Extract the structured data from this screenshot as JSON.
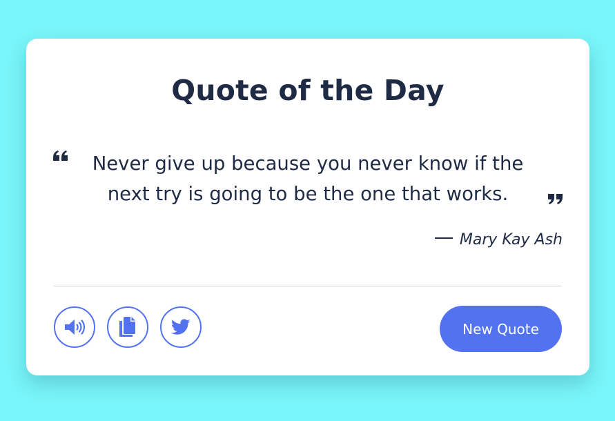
{
  "app": {
    "title": "Quote of the Day"
  },
  "quote": {
    "text": "Never give up because you never know if the next try is going to be the one that works.",
    "author": "Mary Kay Ash",
    "open_mark_icon": "quote-left-icon",
    "close_mark_icon": "quote-right-icon"
  },
  "actions": {
    "speak_icon": "volume-icon",
    "copy_icon": "copy-icon",
    "tweet_icon": "twitter-icon",
    "new_quote_label": "New Quote"
  },
  "colors": {
    "background": "#79f6fb",
    "card": "#ffffff",
    "text": "#1f2a44",
    "accent": "#5372f0"
  }
}
